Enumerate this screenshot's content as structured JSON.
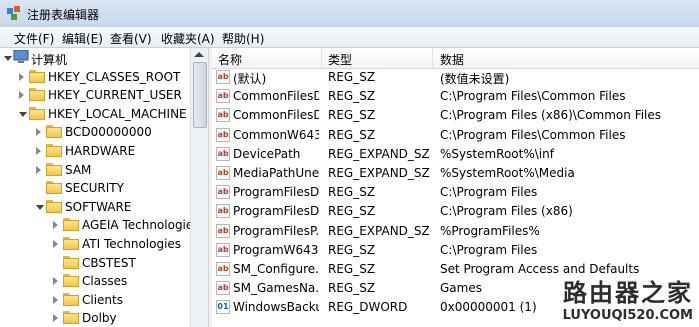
{
  "window": {
    "title": "注册表编辑器"
  },
  "menu": [
    "文件(F)",
    "编辑(E)",
    "查看(V)",
    "收藏夹(A)",
    "帮助(H)"
  ],
  "tree": {
    "root": "计算机",
    "nodes": [
      {
        "label": "HKEY_CLASSES_ROOT",
        "level": 1,
        "expander": "right"
      },
      {
        "label": "HKEY_CURRENT_USER",
        "level": 1,
        "expander": "right"
      },
      {
        "label": "HKEY_LOCAL_MACHINE",
        "level": 1,
        "expander": "down"
      },
      {
        "label": "BCD00000000",
        "level": 2,
        "expander": "right"
      },
      {
        "label": "HARDWARE",
        "level": 2,
        "expander": "right"
      },
      {
        "label": "SAM",
        "level": 2,
        "expander": "right"
      },
      {
        "label": "SECURITY",
        "level": 2,
        "expander": "none"
      },
      {
        "label": "SOFTWARE",
        "level": 2,
        "expander": "down"
      },
      {
        "label": "AGEIA Technologies",
        "level": 3,
        "expander": "right"
      },
      {
        "label": "ATI Technologies",
        "level": 3,
        "expander": "right"
      },
      {
        "label": "CBSTEST",
        "level": 3,
        "expander": "none"
      },
      {
        "label": "Classes",
        "level": 3,
        "expander": "right"
      },
      {
        "label": "Clients",
        "level": 3,
        "expander": "right"
      },
      {
        "label": "Dolby",
        "level": 3,
        "expander": "right"
      }
    ]
  },
  "list": {
    "columns": [
      "名称",
      "类型",
      "数据"
    ],
    "rows": [
      {
        "name": "(默认)",
        "type": "REG_SZ",
        "data": "(数值未设置)",
        "icon": "string"
      },
      {
        "name": "CommonFilesDir",
        "type": "REG_SZ",
        "data": "C:\\Program Files\\Common Files",
        "icon": "string"
      },
      {
        "name": "CommonFilesD...",
        "type": "REG_SZ",
        "data": "C:\\Program Files (x86)\\Common Files",
        "icon": "string"
      },
      {
        "name": "CommonW643...",
        "type": "REG_SZ",
        "data": "C:\\Program Files\\Common Files",
        "icon": "string"
      },
      {
        "name": "DevicePath",
        "type": "REG_EXPAND_SZ",
        "data": "%SystemRoot%\\inf",
        "icon": "string"
      },
      {
        "name": "MediaPathUne...",
        "type": "REG_EXPAND_SZ",
        "data": "%SystemRoot%\\Media",
        "icon": "string"
      },
      {
        "name": "ProgramFilesDir",
        "type": "REG_SZ",
        "data": "C:\\Program Files",
        "icon": "string"
      },
      {
        "name": "ProgramFilesD...",
        "type": "REG_SZ",
        "data": "C:\\Program Files (x86)",
        "icon": "string"
      },
      {
        "name": "ProgramFilesP...",
        "type": "REG_EXPAND_SZ",
        "data": "%ProgramFiles%",
        "icon": "string"
      },
      {
        "name": "ProgramW643...",
        "type": "REG_SZ",
        "data": "C:\\Program Files",
        "icon": "string"
      },
      {
        "name": "SM_Configure...",
        "type": "REG_SZ",
        "data": "Set Program Access and Defaults",
        "icon": "string"
      },
      {
        "name": "SM_GamesNa...",
        "type": "REG_SZ",
        "data": "Games",
        "icon": "string"
      },
      {
        "name": "WindowsBackup",
        "type": "REG_DWORD",
        "data": "0x00000001 (1)",
        "icon": "binary"
      }
    ]
  },
  "watermark": {
    "cn": "路由器之家",
    "en": "LUYOUQI520.COM"
  }
}
